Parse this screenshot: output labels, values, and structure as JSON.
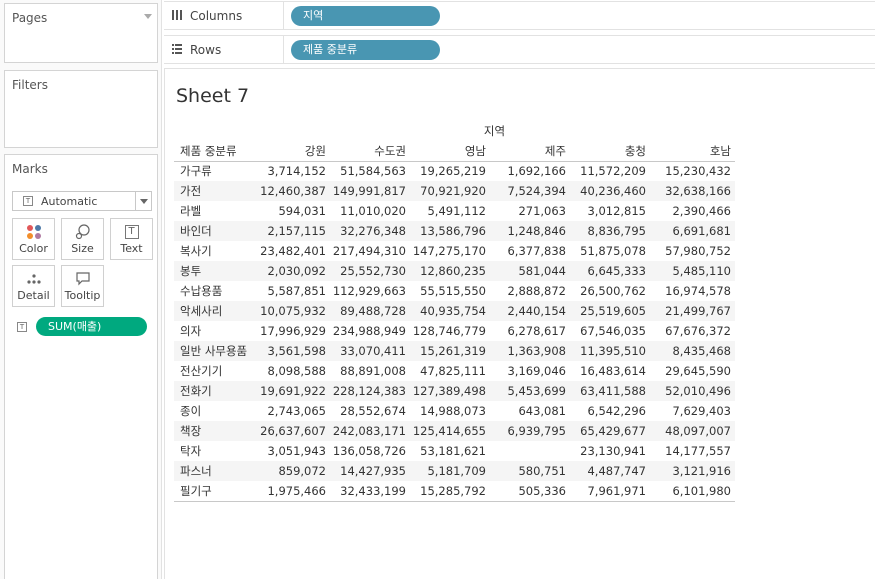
{
  "left_panel": {
    "pages": {
      "title": "Pages"
    },
    "filters": {
      "title": "Filters"
    },
    "marks": {
      "title": "Marks",
      "mark_type": "Automatic",
      "buttons": {
        "color": "Color",
        "size": "Size",
        "text": "Text",
        "detail": "Detail",
        "tooltip": "Tooltip"
      },
      "measure_pill": "SUM(매출)",
      "colors": {
        "pill": "#00a97f"
      }
    }
  },
  "shelves": {
    "columns": {
      "label": "Columns",
      "pill": "지역"
    },
    "rows": {
      "label": "Rows",
      "pill": "제품 중분류"
    },
    "pill_color": "#4996b2"
  },
  "sheet": {
    "title": "Sheet 7",
    "column_field": "지역",
    "row_field": "제품 중분류",
    "columns": [
      "강원",
      "수도권",
      "영남",
      "제주",
      "충청",
      "호남"
    ],
    "rows": [
      {
        "name": "가구류",
        "values": [
          "3,714,152",
          "51,584,563",
          "19,265,219",
          "1,692,166",
          "11,572,209",
          "15,230,432"
        ]
      },
      {
        "name": "가전",
        "values": [
          "12,460,387",
          "149,991,817",
          "70,921,920",
          "7,524,394",
          "40,236,460",
          "32,638,166"
        ]
      },
      {
        "name": "라벨",
        "values": [
          "594,031",
          "11,010,020",
          "5,491,112",
          "271,063",
          "3,012,815",
          "2,390,466"
        ]
      },
      {
        "name": "바인더",
        "values": [
          "2,157,115",
          "32,276,348",
          "13,586,796",
          "1,248,846",
          "8,836,795",
          "6,691,681"
        ]
      },
      {
        "name": "복사기",
        "values": [
          "23,482,401",
          "217,494,310",
          "147,275,170",
          "6,377,838",
          "51,875,078",
          "57,980,752"
        ]
      },
      {
        "name": "봉투",
        "values": [
          "2,030,092",
          "25,552,730",
          "12,860,235",
          "581,044",
          "6,645,333",
          "5,485,110"
        ]
      },
      {
        "name": "수납용품",
        "values": [
          "5,587,851",
          "112,929,663",
          "55,515,550",
          "2,888,872",
          "26,500,762",
          "16,974,578"
        ]
      },
      {
        "name": "악세사리",
        "values": [
          "10,075,932",
          "89,488,728",
          "40,935,754",
          "2,440,154",
          "25,519,605",
          "21,499,767"
        ]
      },
      {
        "name": "의자",
        "values": [
          "17,996,929",
          "234,988,949",
          "128,746,779",
          "6,278,617",
          "67,546,035",
          "67,676,372"
        ]
      },
      {
        "name": "일반 사무용품",
        "values": [
          "3,561,598",
          "33,070,411",
          "15,261,319",
          "1,363,908",
          "11,395,510",
          "8,435,468"
        ]
      },
      {
        "name": "전산기기",
        "values": [
          "8,098,588",
          "88,891,008",
          "47,825,111",
          "3,169,046",
          "16,483,614",
          "29,645,590"
        ]
      },
      {
        "name": "전화기",
        "values": [
          "19,691,922",
          "228,124,383",
          "127,389,498",
          "5,453,699",
          "63,411,588",
          "52,010,496"
        ]
      },
      {
        "name": "종이",
        "values": [
          "2,743,065",
          "28,552,674",
          "14,988,073",
          "643,081",
          "6,542,296",
          "7,629,403"
        ]
      },
      {
        "name": "책장",
        "values": [
          "26,637,607",
          "242,083,171",
          "125,414,655",
          "6,939,795",
          "65,429,677",
          "48,097,007"
        ]
      },
      {
        "name": "탁자",
        "values": [
          "3,051,943",
          "136,058,726",
          "53,181,621",
          "",
          "23,130,941",
          "14,177,557"
        ]
      },
      {
        "name": "파스너",
        "values": [
          "859,072",
          "14,427,935",
          "5,181,709",
          "580,751",
          "4,487,747",
          "3,121,916"
        ]
      },
      {
        "name": "필기구",
        "values": [
          "1,975,466",
          "32,433,199",
          "15,285,792",
          "505,336",
          "7,961,971",
          "6,101,980"
        ]
      }
    ]
  }
}
